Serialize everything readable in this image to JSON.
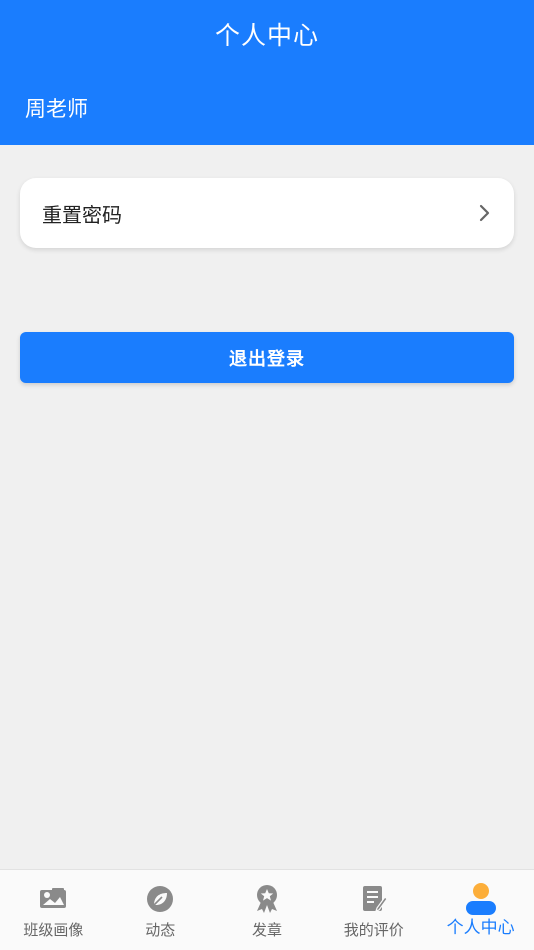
{
  "header": {
    "title": "个人中心",
    "username": "周老师"
  },
  "menu": {
    "reset_password_label": "重置密码"
  },
  "logout_label": "退出登录",
  "tabbar": {
    "items": [
      {
        "label": "班级画像",
        "icon": "class-portrait-icon"
      },
      {
        "label": "动态",
        "icon": "leaf-icon"
      },
      {
        "label": "发章",
        "icon": "medal-icon"
      },
      {
        "label": "我的评价",
        "icon": "edit-document-icon"
      },
      {
        "label": "个人中心",
        "icon": "user-icon",
        "active": true
      }
    ]
  },
  "colors": {
    "primary": "#1a7dfe",
    "background": "#f0f0f0",
    "inactive_icon": "#8a8a8a",
    "user_head": "#fcae3a"
  }
}
